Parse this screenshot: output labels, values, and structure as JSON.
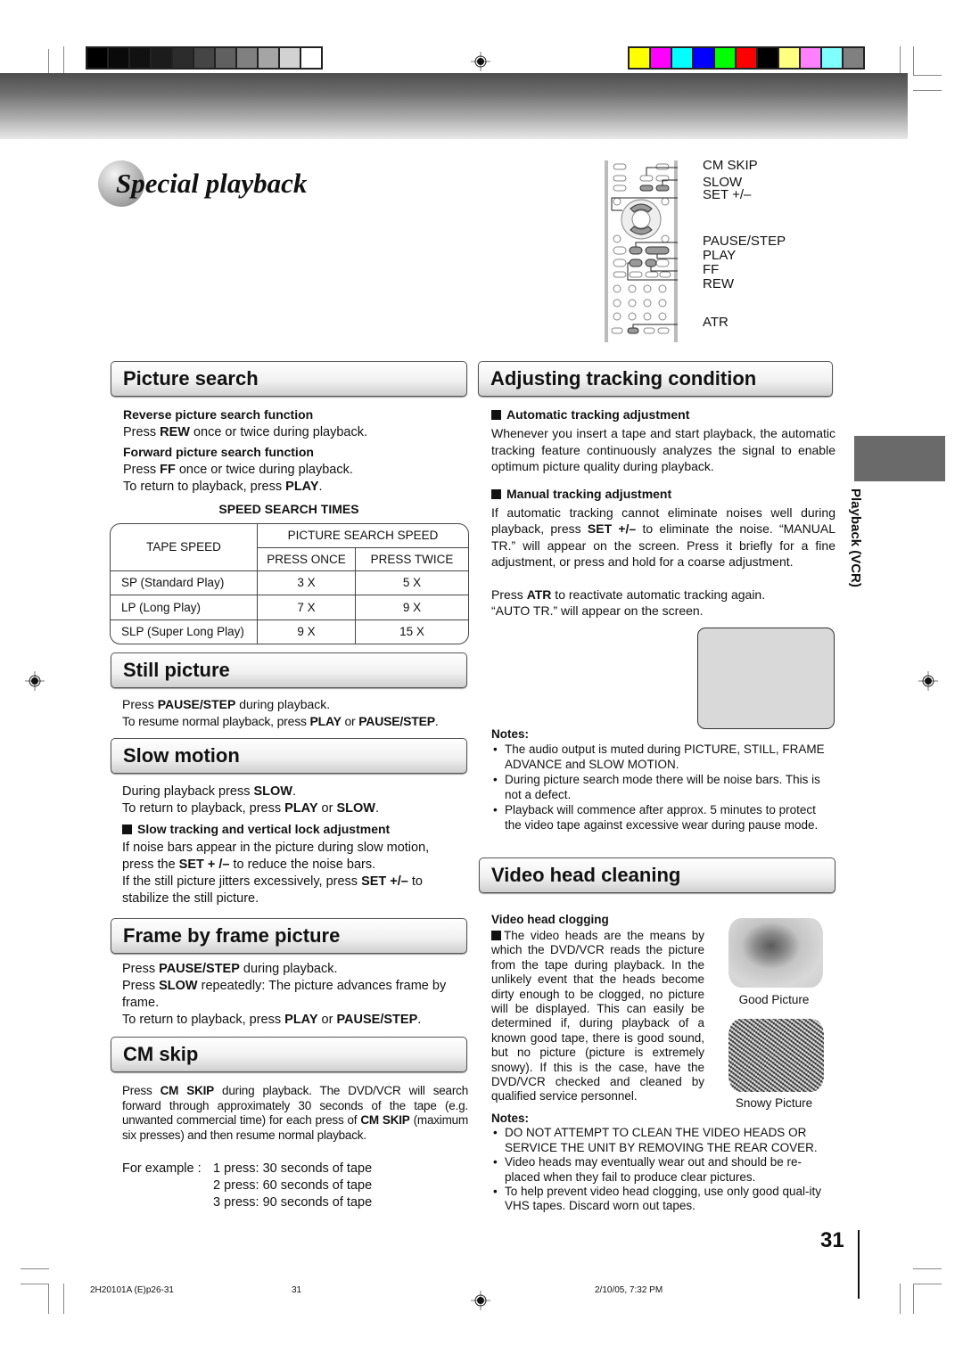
{
  "print_marks": {
    "grayscale_swatches": [
      "#000000",
      "#0a0a0a",
      "#111111",
      "#1c1c1c",
      "#2c2c2c",
      "#454545",
      "#606060",
      "#808080",
      "#a5a5a5",
      "#d2d2d2",
      "#ffffff"
    ],
    "color_swatches": [
      "#ffff00",
      "#ff00ff",
      "#00ffff",
      "#0000ff",
      "#00ff00",
      "#ff0000",
      "#000000",
      "#ffff80",
      "#ff80ff",
      "#80ffff",
      "#808080"
    ]
  },
  "page": {
    "title": "Special playback",
    "side_tab_label": "Playback (VCR)",
    "page_number": "31"
  },
  "remote": {
    "labels": [
      "CM SKIP",
      "SLOW",
      "SET +/–",
      "PAUSE/STEP",
      "PLAY",
      "FF",
      "REW",
      "ATR"
    ]
  },
  "picture_search": {
    "heading": "Picture search",
    "reverse_title": "Reverse picture search function",
    "reverse_pre": "Press ",
    "reverse_key": "REW",
    "reverse_post": " once or twice during playback.",
    "forward_title": "Forward picture search function",
    "forward_pre": "Press ",
    "forward_key": "FF",
    "forward_post": " once or twice during playback.",
    "return_pre": "To return to playback, press ",
    "return_key": "PLAY",
    "return_post": ".",
    "table_title": "SPEED SEARCH TIMES",
    "table": {
      "col_tape": "TAPE SPEED",
      "col_group": "PICTURE SEARCH SPEED",
      "col_once": "PRESS ONCE",
      "col_twice": "PRESS TWICE",
      "rows": [
        {
          "tape": "SP (Standard Play)",
          "once": "3 X",
          "twice": "5 X"
        },
        {
          "tape": "LP (Long Play)",
          "once": "7 X",
          "twice": "9 X"
        },
        {
          "tape": "SLP (Super Long Play)",
          "once": "9 X",
          "twice": "15 X"
        }
      ]
    }
  },
  "still_picture": {
    "heading": "Still picture",
    "l1_pre": "Press ",
    "l1_key": "PAUSE/STEP",
    "l1_post": " during playback.",
    "l2_pre": "To resume normal playback, press ",
    "l2_key1": "PLAY",
    "l2_mid": " or ",
    "l2_key2": "PAUSE/STEP",
    "l2_post": "."
  },
  "slow_motion": {
    "heading": "Slow motion",
    "l1_pre": "During playback press ",
    "l1_key": "SLOW",
    "l1_post": ".",
    "l2_pre": "To return to playback, press ",
    "l2_key1": "PLAY",
    "l2_mid": " or ",
    "l2_key2": "SLOW",
    "l2_post": ".",
    "sub_title": "Slow tracking and vertical lock adjustment",
    "p1_pre": "If noise bars appear in the picture during slow motion, press the ",
    "p1_key": "SET + /–",
    "p1_post": " to reduce the noise bars.",
    "p2_pre": "If the still picture jitters excessively, press ",
    "p2_key": "SET +/–",
    "p2_post": " to stabilize the still picture."
  },
  "frame_by_frame": {
    "heading": "Frame by frame picture",
    "l1_pre": "Press ",
    "l1_key": "PAUSE/STEP",
    "l1_post": " during playback.",
    "l2_pre": "Press ",
    "l2_key": "SLOW",
    "l2_post": " repeatedly: The picture advances frame by frame.",
    "l3_pre": "To return to playback, press ",
    "l3_key1": "PLAY",
    "l3_mid": " or ",
    "l3_key2": "PAUSE/STEP",
    "l3_post": "."
  },
  "cm_skip": {
    "heading": "CM skip",
    "p_pre": "Press ",
    "p_key1": "CM SKIP",
    "p_mid": " during playback. The DVD/VCR will search forward through approximately 30 seconds of the tape (e.g. unwanted commercial time) for each press of ",
    "p_key2": "CM SKIP",
    "p_post": " (maximum six presses) and then resume normal playback.",
    "example_label": "For example :",
    "examples": [
      "1 press: 30 seconds of tape",
      "2 press: 60 seconds of tape",
      "3 press: 90 seconds of tape"
    ]
  },
  "tracking": {
    "heading": "Adjusting tracking condition",
    "auto_title": "Automatic tracking adjustment",
    "auto_text": "Whenever you insert a tape and start playback, the automatic tracking feature continuously analyzes the signal to enable optimum picture quality during playback.",
    "manual_title": "Manual tracking adjustment",
    "manual_pre": "If automatic tracking cannot eliminate noises well during playback, press ",
    "manual_key": "SET +/–",
    "manual_post": " to eliminate the noise. “MANUAL TR.” will appear on the screen. Press it briefly for a fine adjustment, or press and hold for a coarse adjustment.",
    "atr_pre": "Press ",
    "atr_key": "ATR",
    "atr_post": " to reactivate automatic tracking again.",
    "atr_line2": "“AUTO TR.” will appear on the screen.",
    "notes_title": "Notes:",
    "notes": [
      "The audio output is muted during PICTURE, STILL, FRAME ADVANCE and SLOW MOTION.",
      "During picture search mode there will be noise bars. This is not a defect.",
      "Playback will commence after approx. 5 minutes to protect the video tape against excessive wear during pause mode."
    ]
  },
  "head_cleaning": {
    "heading": "Video head cleaning",
    "sub_title": "Video head clogging",
    "text": "The video heads are the means by which the DVD/VCR reads the picture from the tape during playback. In the unlikely event that the heads become dirty enough to be clogged, no picture will be displayed. This can easily be determined if, during playback of a known good tape, there is good sound, but no picture (picture is extremely snowy). If this is the case, have the DVD/VCR checked and cleaned by qualified service personnel.",
    "good_caption": "Good Picture",
    "snowy_caption": "Snowy Picture",
    "notes_title": "Notes:",
    "notes": [
      "DO NOT ATTEMPT TO CLEAN THE VIDEO HEADS OR SERVICE THE UNIT BY REMOVING THE REAR COVER.",
      "Video heads may eventually wear out and should be re-placed when they fail to produce clear pictures.",
      "To help prevent video head clogging, use only good qual-ity VHS tapes. Discard worn out tapes."
    ]
  },
  "footer": {
    "file": "2H20101A (E)p26-31",
    "page": "31",
    "timestamp": "2/10/05, 7:32 PM"
  }
}
